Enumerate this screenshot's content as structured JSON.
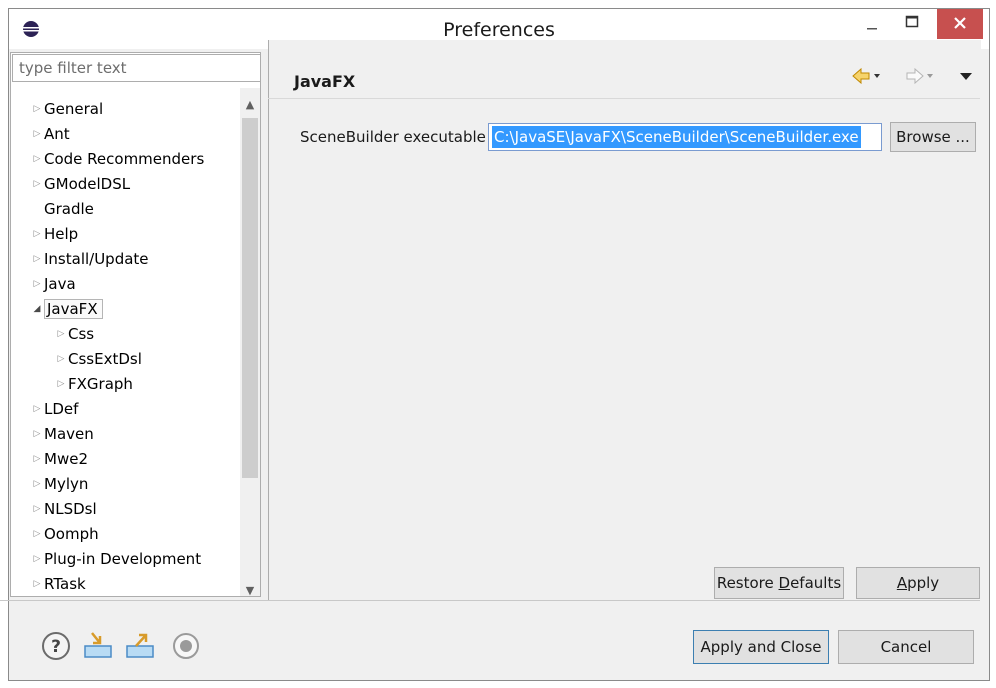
{
  "window": {
    "title": "Preferences"
  },
  "filter": {
    "placeholder": "type filter text"
  },
  "tree": [
    {
      "label": "General",
      "expanded": false
    },
    {
      "label": "Ant",
      "expanded": false
    },
    {
      "label": "Code Recommenders",
      "expanded": false
    },
    {
      "label": "GModelDSL",
      "expanded": false
    },
    {
      "label": "Gradle",
      "expanded": false
    },
    {
      "label": "Help",
      "expanded": false
    },
    {
      "label": "Install/Update",
      "expanded": false
    },
    {
      "label": "Java",
      "expanded": false
    },
    {
      "label": "JavaFX",
      "expanded": true,
      "selected": true
    },
    {
      "label": "Css",
      "expanded": false
    },
    {
      "label": "CssExtDsl",
      "expanded": false
    },
    {
      "label": "FXGraph",
      "expanded": false
    },
    {
      "label": "LDef",
      "expanded": false
    },
    {
      "label": "Maven",
      "expanded": false
    },
    {
      "label": "Mwe2",
      "expanded": false
    },
    {
      "label": "Mylyn",
      "expanded": false
    },
    {
      "label": "NLSDsl",
      "expanded": false
    },
    {
      "label": "Oomph",
      "expanded": false
    },
    {
      "label": "Plug-in Development",
      "expanded": false
    },
    {
      "label": "RTask",
      "expanded": false
    }
  ],
  "page": {
    "title": "JavaFX",
    "field_label": "SceneBuilder executable",
    "field_value": "C:\\JavaSE\\JavaFX\\SceneBuilder\\SceneBuilder.exe",
    "browse_label": "Browse ..."
  },
  "buttons": {
    "restore_label_pre": "Restore ",
    "restore_label_u": "D",
    "restore_label_post": "efaults",
    "apply_label_u": "A",
    "apply_label_post": "pply",
    "apply_close_label": "Apply and Close",
    "cancel_label": "Cancel"
  },
  "colors": {
    "close_button": "#c7504f",
    "selection": "#3399ff",
    "nav_back": "#e8a800"
  }
}
